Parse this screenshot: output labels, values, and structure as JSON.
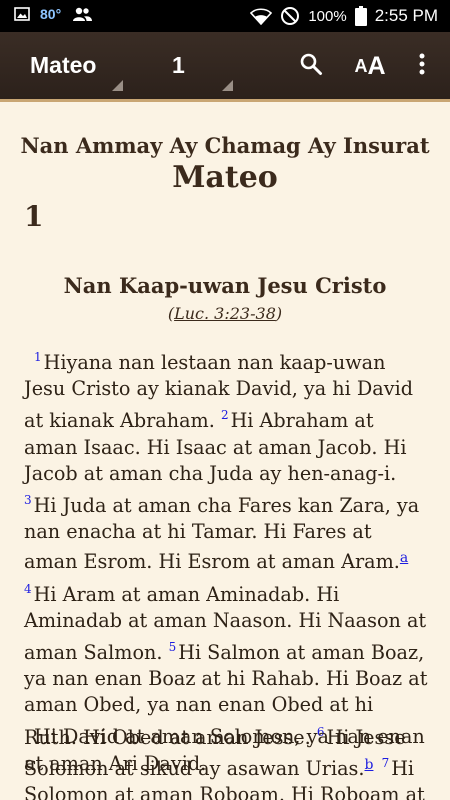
{
  "status_bar": {
    "temperature": "80°",
    "battery_percent": "100%",
    "time": "2:55 PM"
  },
  "app_bar": {
    "book": "Mateo",
    "chapter": "1",
    "font_size_label_small": "A",
    "font_size_label_large": "A"
  },
  "content": {
    "bible_title": "Nan Ammay Ay Chamag Ay Insurat",
    "book_heading": "Mateo",
    "chapter_number": "1",
    "section_heading": "Nan Kaap-uwan Jesu Cristo",
    "cross_reference": {
      "open": "(",
      "link": "Luc. 3:23-38",
      "close": ")"
    },
    "paragraph1": [
      {
        "num": "1",
        "text": "Hiyana nan lestaan nan kaap-uwan Jesu Cristo ay kianak David, ya hi David at kianak Abraham."
      },
      {
        "num": "2",
        "text": "Hi Abraham at aman Isaac. Hi Isaac at aman Jacob. Hi Jacob at aman cha Juda ay hen-anag-i."
      },
      {
        "num": "3",
        "text": "Hi Juda at aman cha Fares kan Zara, ya nan enacha at hi Tamar. Hi Fares at aman Esrom. Hi Esrom at aman Aram.",
        "footnote": "a"
      },
      {
        "num": "4",
        "text": "Hi Aram at aman Aminadab. Hi Aminadab at aman Naason. Hi Naason at aman Salmon."
      },
      {
        "num": "5",
        "text": "Hi Salmon at aman Boaz, ya nan enan Boaz at hi Rahab. Hi Boaz at aman Obed, ya nan enan Obed at hi Ruth. Hi Obed at aman Jesse."
      },
      {
        "num": "6",
        "text": "Hi Jesse at aman Ari David."
      }
    ],
    "paragraph2": [
      {
        "text": "Hi David at aman Solomon, ya nan enan Solomon at sikud ay asawan Urias.",
        "footnote": "b"
      },
      {
        "num": "7",
        "text": "Hi Solomon at aman Roboam. Hi Roboam at"
      }
    ]
  },
  "icons": {
    "gallery": "image-icon",
    "people": "people-icon",
    "wifi": "wifi-icon",
    "dnd": "do-not-disturb-icon",
    "battery": "battery-icon",
    "search": "search-icon",
    "font_size": "font-size-icon",
    "menu": "more-vert-icon"
  }
}
